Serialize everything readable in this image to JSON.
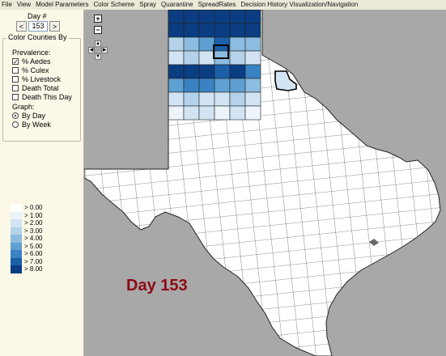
{
  "menubar": [
    "File",
    "View",
    "Model Parameters",
    "Color Scheme",
    "Spray",
    "Quarantine",
    "SpreadRates",
    "Decision History Visualization/Navigation"
  ],
  "day": {
    "label": "Day #",
    "value": "153",
    "prev": "<",
    "next": ">"
  },
  "color_counties": {
    "title": "Color Counties By",
    "prevalence_label": "Prevalence:",
    "options": [
      {
        "label": "% Aedes",
        "checked": true
      },
      {
        "label": "% Culex",
        "checked": false
      },
      {
        "label": "% Livestock",
        "checked": false
      },
      {
        "label": "Death Total",
        "checked": false
      },
      {
        "label": "Death This Day",
        "checked": false
      }
    ],
    "graph_label": "Graph:",
    "graph_options": [
      {
        "label": "By Day",
        "selected": true
      },
      {
        "label": "By Week",
        "selected": false
      }
    ]
  },
  "legend": [
    {
      "label": "> 0.00",
      "color": "#ffffff"
    },
    {
      "label": "> 1.00",
      "color": "#ebf3fb"
    },
    {
      "label": "> 2.00",
      "color": "#d2e4f3"
    },
    {
      "label": "> 3.00",
      "color": "#b4d2ea"
    },
    {
      "label": "> 4.00",
      "color": "#8cbce0"
    },
    {
      "label": "> 5.00",
      "color": "#5ea0d2"
    },
    {
      "label": "> 6.00",
      "color": "#3a82c2"
    },
    {
      "label": "> 7.00",
      "color": "#1a5fa8"
    },
    {
      "label": "> 8.00",
      "color": "#0a3d82"
    }
  ],
  "map": {
    "overlay_text": "Day 153",
    "zoom_in": "+",
    "zoom_out": "−",
    "pan": {
      "up": "▲",
      "down": "▼",
      "left": "◀",
      "right": "▶"
    },
    "colors": {
      "land": "#ffffff",
      "background": "#a8a8a8",
      "border": "#222222"
    },
    "panhandle_levels": [
      [
        8,
        8,
        8,
        8,
        8,
        8
      ],
      [
        8,
        8,
        8,
        8,
        8,
        8
      ],
      [
        3,
        4,
        5,
        7,
        4,
        4
      ],
      [
        2,
        3,
        2,
        4,
        3,
        2
      ],
      [
        8,
        8,
        8,
        7,
        8,
        6
      ],
      [
        5,
        6,
        6,
        5,
        5,
        4
      ],
      [
        2,
        3,
        2,
        2,
        3,
        2
      ],
      [
        1,
        2,
        2,
        1,
        2,
        1
      ]
    ]
  }
}
